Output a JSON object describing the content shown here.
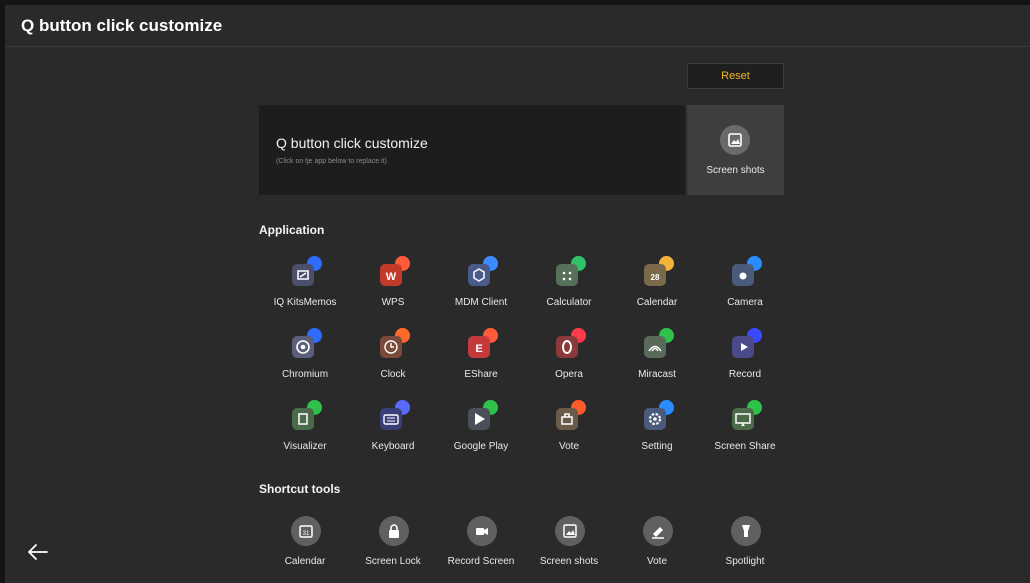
{
  "header": {
    "title": "Q button click customize"
  },
  "reset_label": "Reset",
  "current": {
    "title": "Q button click customize",
    "subtitle": "(Click on tje app below to replace it)",
    "selected": {
      "label": "Screen shots",
      "icon": "screenshot-icon"
    }
  },
  "application": {
    "heading": "Application",
    "apps": [
      {
        "label": "IQ KitsMemos",
        "icon": "memo-icon",
        "bubble": "#2f6bff",
        "box": "#4b4f6a"
      },
      {
        "label": "WPS",
        "icon": "wps-icon",
        "bubble": "#ff5a3a",
        "box": "#c43a2a"
      },
      {
        "label": "MDM Client",
        "icon": "mdm-icon",
        "bubble": "#3a8bff",
        "box": "#4a5a8a"
      },
      {
        "label": "Calculator",
        "icon": "calculator-icon",
        "bubble": "#2ec26a",
        "box": "#56705a"
      },
      {
        "label": "Calendar",
        "icon": "calendar-icon",
        "bubble": "#f3b23a",
        "box": "#7a6a4a"
      },
      {
        "label": "Camera",
        "icon": "camera-icon",
        "bubble": "#2a8bff",
        "box": "#4a5a7a"
      },
      {
        "label": "Chromium",
        "icon": "chromium-icon",
        "bubble": "#2f6bff",
        "box": "#5a5f7a"
      },
      {
        "label": "Clock",
        "icon": "clock-icon",
        "bubble": "#ff6a2a",
        "box": "#7a4a3a"
      },
      {
        "label": "EShare",
        "icon": "eshare-icon",
        "bubble": "#ff5a3a",
        "box": "#c43a3a"
      },
      {
        "label": "Opera",
        "icon": "opera-icon",
        "bubble": "#ff3a4a",
        "box": "#8a3a3a"
      },
      {
        "label": "Miracast",
        "icon": "miracast-icon",
        "bubble": "#2ec24a",
        "box": "#5a6a5a"
      },
      {
        "label": "Record",
        "icon": "record-icon",
        "bubble": "#3a4aff",
        "box": "#4a4a8a"
      },
      {
        "label": "Visualizer",
        "icon": "visualizer-icon",
        "bubble": "#2ec24a",
        "box": "#4a6a4a"
      },
      {
        "label": "Keyboard",
        "icon": "keyboard-icon",
        "bubble": "#5a6aff",
        "box": "#3a3f7a"
      },
      {
        "label": "Google Play",
        "icon": "google-play-icon",
        "bubble": "#2ec24a",
        "box": "#4a4f5a"
      },
      {
        "label": "Vote",
        "icon": "vote-icon",
        "bubble": "#ff5a2a",
        "box": "#6a5a4a"
      },
      {
        "label": "Setting",
        "icon": "setting-icon",
        "bubble": "#2a8bff",
        "box": "#4a5a7a"
      },
      {
        "label": "Screen Share",
        "icon": "screen-share-icon",
        "bubble": "#2ec24a",
        "box": "#4a6a4a"
      }
    ]
  },
  "shortcut_tools": {
    "heading": "Shortcut tools",
    "tools": [
      {
        "label": "Calendar",
        "icon": "calendar-icon"
      },
      {
        "label": "Screen Lock",
        "icon": "lock-icon"
      },
      {
        "label": "Record Screen",
        "icon": "record-screen-icon"
      },
      {
        "label": "Screen shots",
        "icon": "screenshot-icon"
      },
      {
        "label": "Vote",
        "icon": "vote-icon"
      },
      {
        "label": "Spotlight",
        "icon": "spotlight-icon"
      }
    ]
  },
  "colors": {
    "background": "#2a2a2a",
    "panel": "#1d1d1d",
    "accent": "#f0b429"
  }
}
